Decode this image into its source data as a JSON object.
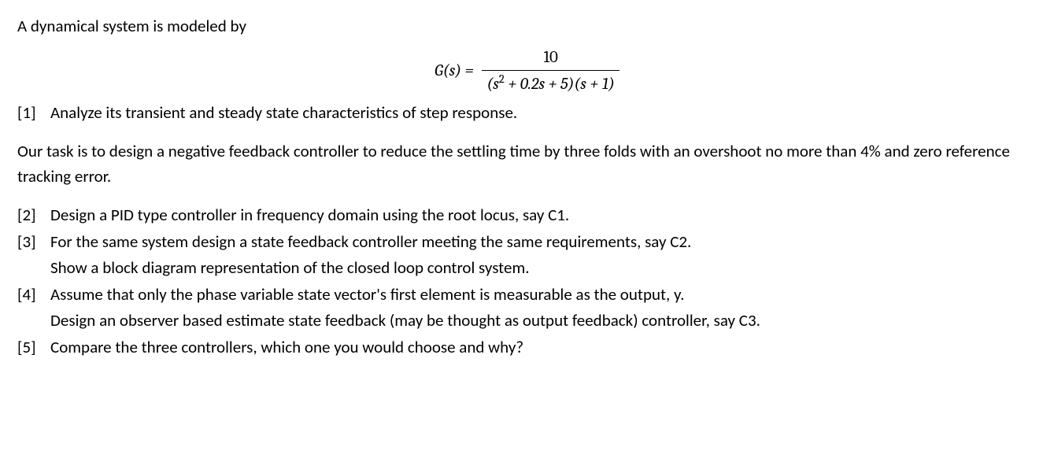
{
  "intro": "A dynamical system is modeled by",
  "equation": {
    "lhs": "G(s) =",
    "numerator": "10",
    "den_part1": "(s",
    "den_sup": "2",
    "den_part2": " + 0.2s + 5)(s + 1)"
  },
  "items": {
    "q1": {
      "num": "[1]",
      "text": "Analyze its transient and steady state characteristics of step response."
    },
    "task_para": "Our task is to design a negative feedback controller to reduce the settling time by three folds with an overshoot no more than 4% and zero reference tracking error.",
    "q2": {
      "num": "[2]",
      "text": "Design a PID type controller in frequency domain using the root locus, say C1."
    },
    "q3": {
      "num": "[3]",
      "text": "For the same system design a state feedback controller meeting the same requirements, say C2.",
      "cont": "Show a block diagram representation of the closed loop control system."
    },
    "q4": {
      "num": "[4]",
      "text": "Assume that only the phase variable state vector's first element is measurable as the output, y.",
      "cont": "Design an observer based estimate state feedback (may be thought as output feedback) controller, say C3."
    },
    "q5": {
      "num": "[5]",
      "text": "Compare the three controllers, which one you would choose and why?"
    }
  }
}
